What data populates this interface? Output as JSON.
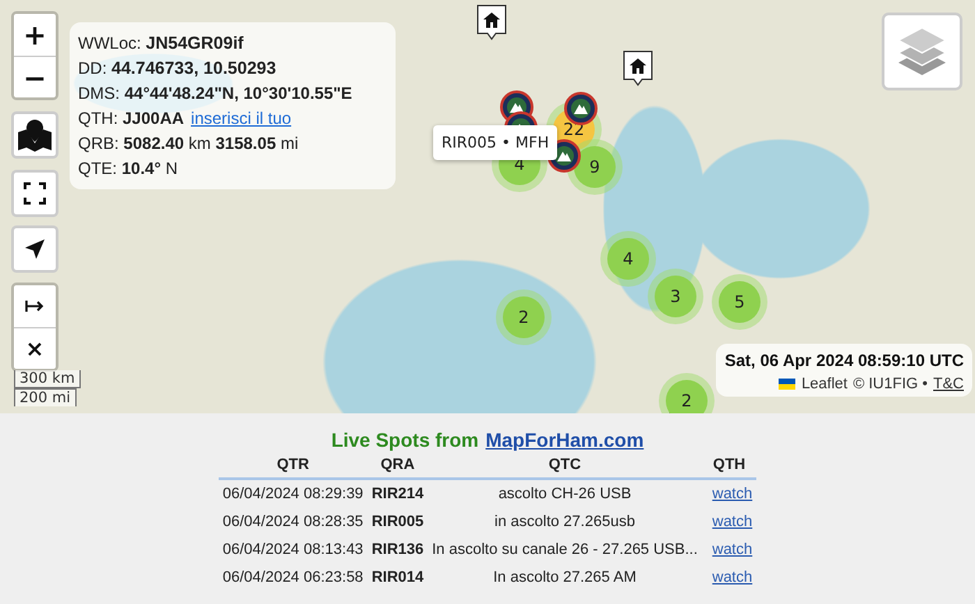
{
  "map": {
    "controls": {
      "zoom_in": "+",
      "zoom_out": "−",
      "clear": "×"
    },
    "info": {
      "wwloc_label": "WWLoc:",
      "wwloc": "JN54GR09if",
      "dd": "DD: **44.746733, 10.50293**",
      "dms": "DMS: **44°44'48.24\"N, 10°30'10.55\"E**",
      "qth": "QTH: **JJ00AA**",
      "qth_link": "inserisci il tuo",
      "qrb": "QRB: **5082.40** km **3158.05** mi",
      "qte": "QTE: **10.4°** N"
    },
    "scale": {
      "km": "300 km",
      "mi": "200 mi"
    },
    "clusters": [
      {
        "count": "22",
        "color": "#f5c542"
      },
      {
        "count": "4",
        "color": "#8fd14f"
      },
      {
        "count": "9",
        "color": "#8fd14f"
      },
      {
        "count": "4",
        "color": "#8fd14f"
      },
      {
        "count": "3",
        "color": "#8fd14f"
      },
      {
        "count": "5",
        "color": "#8fd14f"
      },
      {
        "count": "2",
        "color": "#8fd14f"
      },
      {
        "count": "2",
        "color": "#8fd14f"
      }
    ],
    "tooltip": "RIR005 • MFH",
    "clock": "Sat, 06 Apr 2024 08:59:10 UTC",
    "attribution": {
      "leaflet": "Leaflet",
      "owner": "© IU1FIG •",
      "terms": "T&C"
    }
  },
  "spots": {
    "title": "Live Spots from",
    "site": "MapForHam.com",
    "columns": [
      "QTR",
      "QRA",
      "QTC",
      "QTH"
    ],
    "rows": [
      {
        "qtr": "06/04/2024 08:29:39",
        "qra": "RIR214",
        "qtc": "ascolto CH-26 USB",
        "qth": "watch"
      },
      {
        "qtr": "06/04/2024 08:28:35",
        "qra": "RIR005",
        "qtc": "in ascolto 27.265usb",
        "qth": "watch"
      },
      {
        "qtr": "06/04/2024 08:13:43",
        "qra": "RIR136",
        "qtc": "In ascolto su canale 26 - 27.265 USB...",
        "qth": "watch"
      },
      {
        "qtr": "06/04/2024 06:23:58",
        "qra": "RIR014",
        "qtc": "In ascolto 27.265 AM",
        "qth": "watch"
      }
    ]
  }
}
